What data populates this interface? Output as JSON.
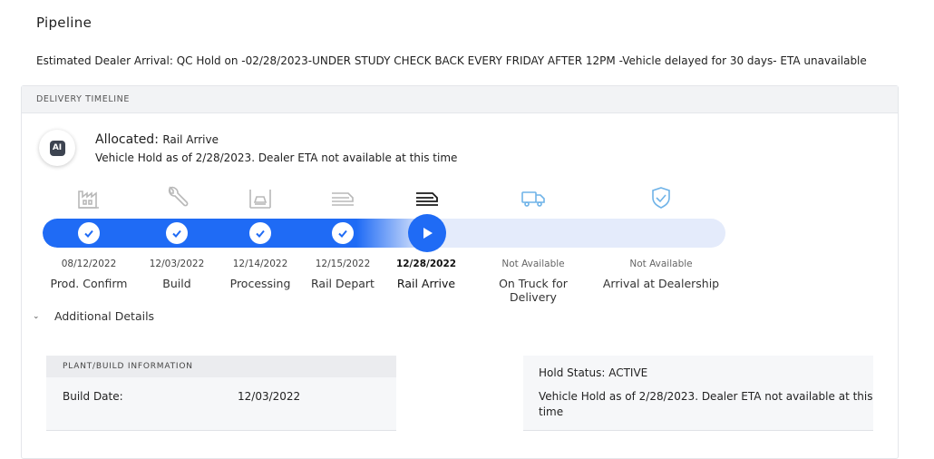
{
  "page": {
    "title": "Pipeline",
    "eta": "Estimated Dealer Arrival: QC Hold on -02/28/2023-UNDER STUDY CHECK BACK EVERY FRIDAY AFTER 12PM -Vehicle delayed for 30 days- ETA unavailable"
  },
  "timeline": {
    "header": "DELIVERY TIMELINE",
    "badge": "AI",
    "status_label": "Allocated:",
    "status_value": "Rail Arrive",
    "status_sub": "Vehicle Hold as of 2/28/2023. Dealer ETA not available at this time",
    "progress_fraction": 0.56,
    "accent_color": "#1f6bf5",
    "steps": [
      {
        "icon": "factory-icon",
        "date": "08/12/2022",
        "label": "Prod. Confirm",
        "state": "done"
      },
      {
        "icon": "wrench-icon",
        "date": "12/03/2022",
        "label": "Build",
        "state": "done"
      },
      {
        "icon": "processing-icon",
        "date": "12/14/2022",
        "label": "Processing",
        "state": "done"
      },
      {
        "icon": "rail-depart-icon",
        "date": "12/15/2022",
        "label": "Rail Depart",
        "state": "done"
      },
      {
        "icon": "rail-arrive-icon",
        "date": "12/28/2022",
        "label": "Rail Arrive",
        "state": "current"
      },
      {
        "icon": "truck-icon",
        "date": "Not Available",
        "label": "On Truck for Delivery",
        "state": "pending"
      },
      {
        "icon": "shield-check-icon",
        "date": "Not Available",
        "label": "Arrival at Dealership",
        "state": "pending"
      }
    ]
  },
  "details": {
    "toggle_label": "Additional Details",
    "plant": {
      "header": "PLANT/BUILD INFORMATION",
      "build_date_label": "Build Date:",
      "build_date_value": "12/03/2022"
    },
    "hold": {
      "status": "Hold Status: ACTIVE",
      "message": "Vehicle Hold as of 2/28/2023. Dealer ETA not available at this time"
    }
  }
}
